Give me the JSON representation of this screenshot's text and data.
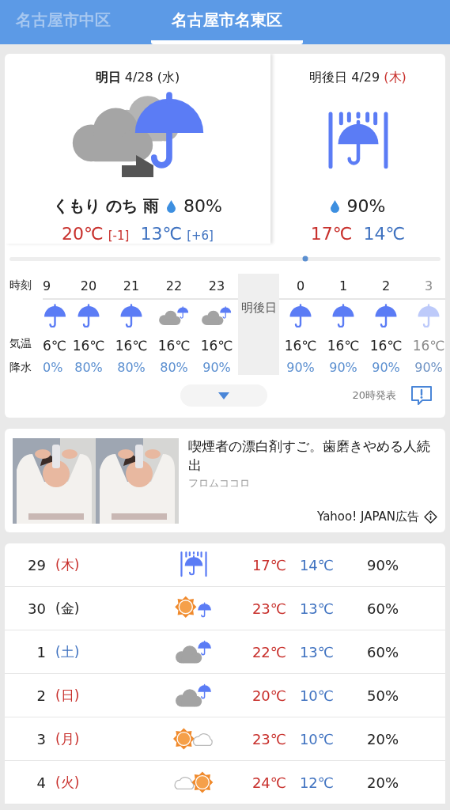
{
  "tabs": [
    {
      "label": "名古屋市中区",
      "selected": false
    },
    {
      "label": "名古屋市名東区",
      "selected": true
    }
  ],
  "forecast": {
    "panels": [
      {
        "title": "**明日** 4/28",
        "weekday": "(水)",
        "color": "#222222",
        "kind": "cloudy-then-rain",
        "condition": "くもり のち 雨",
        "pop": "80%",
        "high": "20℃",
        "high_diff": "[-1]",
        "low": "13℃",
        "low_diff": "[+6]"
      },
      {
        "title": "明後日 4/29",
        "weekday": "(木)",
        "color": "#c8302c",
        "kind": "heavy-rain",
        "pop": "90%",
        "high": "17℃",
        "low": "14℃"
      }
    ],
    "row_labels": [
      "時刻",
      "気温",
      "降水"
    ],
    "columns": [
      {
        "kind": "rain",
        "time": "9",
        "temp": "6℃",
        "pop": "0%",
        "faded": false
      },
      {
        "kind": "rain",
        "time": "20",
        "temp": "16℃",
        "pop": "80%",
        "faded": false
      },
      {
        "kind": "rain",
        "time": "21",
        "temp": "16℃",
        "pop": "80%",
        "faded": false
      },
      {
        "kind": "cloud-rain",
        "time": "22",
        "temp": "16℃",
        "pop": "80%",
        "faded": false
      },
      {
        "kind": "cloud-rain",
        "time": "23",
        "temp": "16℃",
        "pop": "90%",
        "faded": false
      },
      {
        "kind": "day-break",
        "label": "明後日"
      },
      {
        "kind": "rain",
        "time": "0",
        "temp": "16℃",
        "pop": "90%",
        "faded": false
      },
      {
        "kind": "rain",
        "time": "1",
        "temp": "16℃",
        "pop": "90%",
        "faded": false
      },
      {
        "kind": "rain",
        "time": "2",
        "temp": "16℃",
        "pop": "90%",
        "faded": false
      },
      {
        "kind": "rain",
        "time": "3",
        "temp": "16℃",
        "pop": "90%",
        "faded": true
      }
    ],
    "issued": "20時発表"
  },
  "ad": {
    "title": "喫煙者の漂白剤すご。歯磨きやめる人続出",
    "source": "フロムココロ",
    "sponsor": "Yahoo! JAPAN広告"
  },
  "daily": [
    {
      "date": "29",
      "weekday": "(木)",
      "color": "#c8302c",
      "kind": "heavy-rain",
      "high": "17℃",
      "low": "14℃",
      "pop": "90%"
    },
    {
      "date": "30",
      "weekday": "(金)",
      "color": "#222222",
      "kind": "sun-rain",
      "high": "23℃",
      "low": "13℃",
      "pop": "60%"
    },
    {
      "date": "1",
      "weekday": "(土)",
      "color": "#3f72c0",
      "kind": "cloud-rain",
      "high": "22℃",
      "low": "13℃",
      "pop": "60%"
    },
    {
      "date": "2",
      "weekday": "(日)",
      "color": "#c8302c",
      "kind": "cloud-rain",
      "high": "20℃",
      "low": "10℃",
      "pop": "50%"
    },
    {
      "date": "3",
      "weekday": "(月)",
      "color": "#c8302c",
      "kind": "sun-cloud",
      "high": "23℃",
      "low": "10℃",
      "pop": "20%"
    },
    {
      "date": "4",
      "weekday": "(火)",
      "color": "#c8302c",
      "kind": "cloud-sun",
      "high": "24℃",
      "low": "12℃",
      "pop": "20%"
    }
  ]
}
